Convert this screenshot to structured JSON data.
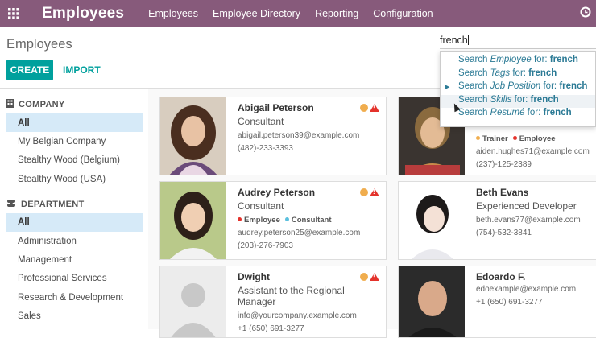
{
  "topbar": {
    "app_title": "Employees",
    "menu": [
      "Employees",
      "Employee Directory",
      "Reporting",
      "Configuration"
    ],
    "icons": {
      "apps": "apps-grid-icon",
      "clock": "activity-clock-icon"
    }
  },
  "control_panel": {
    "breadcrumb": "Employees",
    "create_label": "CREATE",
    "import_label": "IMPORT",
    "search_value": "french"
  },
  "search_dropdown": [
    {
      "prefix": "Search ",
      "field": "Employee",
      "mid": " for: ",
      "term": "french"
    },
    {
      "prefix": "Search ",
      "field": "Tags",
      "mid": " for: ",
      "term": "french"
    },
    {
      "prefix": "Search ",
      "field": "Job Position",
      "mid": " for: ",
      "term": "french"
    },
    {
      "prefix": "Search ",
      "field": "Skills",
      "mid": " for: ",
      "term": "french"
    },
    {
      "prefix": "Search ",
      "field": "Resumé",
      "mid": " for: ",
      "term": "french"
    }
  ],
  "sidebar": {
    "company_header": "COMPANY",
    "company_items": [
      "All",
      "My Belgian Company",
      "Stealthy Wood (Belgium)",
      "Stealthy Wood (USA)"
    ],
    "department_header": "DEPARTMENT",
    "department_items": [
      "All",
      "Administration",
      "Management",
      "Professional Services",
      "Research & Development",
      "Sales"
    ]
  },
  "employees": [
    {
      "name": "Abigail Peterson",
      "job": "Consultant",
      "tags": [],
      "email": "abigail.peterson39@example.com",
      "phone": "(482)-233-3393"
    },
    {
      "name": "",
      "job": "",
      "tags": [
        {
          "label": "Trainer",
          "color": "#f0ad4e"
        },
        {
          "label": "Employee",
          "color": "#e4322b"
        }
      ],
      "email": "aiden.hughes71@example.com",
      "phone": "(237)-125-2389"
    },
    {
      "name": "Audrey Peterson",
      "job": "Consultant",
      "tags": [
        {
          "label": "Employee",
          "color": "#e4322b"
        },
        {
          "label": "Consultant",
          "color": "#5bc0de"
        }
      ],
      "email": "audrey.peterson25@example.com",
      "phone": "(203)-276-7903"
    },
    {
      "name": "Beth Evans",
      "job": "Experienced Developer",
      "tags": [],
      "email": "beth.evans77@example.com",
      "phone": "(754)-532-3841"
    },
    {
      "name": "Dwight",
      "job": "Assistant to the Regional Manager",
      "tags": [],
      "email": "info@yourcompany.example.com",
      "phone": "+1 (650) 691-3277"
    },
    {
      "name": "Edoardo F.",
      "job": "",
      "tags": [],
      "email": "edoexample@example.com",
      "phone": "+1 (650) 691-3277"
    }
  ]
}
